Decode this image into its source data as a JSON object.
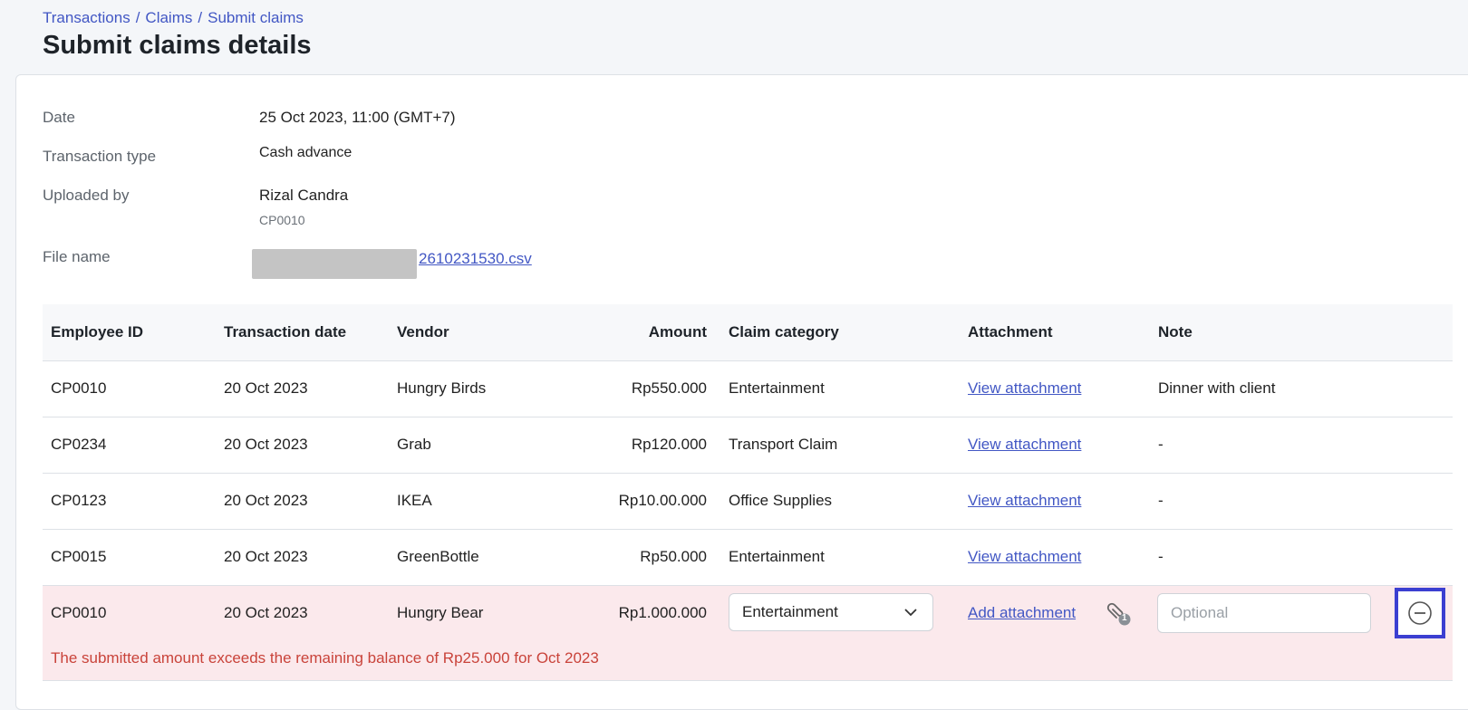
{
  "breadcrumb": {
    "items": [
      "Transactions",
      "Claims",
      "Submit claims"
    ],
    "sep": "/"
  },
  "page_title": "Submit claims details",
  "details": {
    "date_label": "Date",
    "date_value": "25 Oct 2023, 11:00 (GMT+7)",
    "type_label": "Transaction type",
    "type_value": "Cash advance",
    "uploaded_label": "Uploaded by",
    "uploaded_name": "Rizal Candra",
    "uploaded_id": "CP0010",
    "file_label": "File name",
    "file_value": "2610231530.csv"
  },
  "table": {
    "headers": [
      "Employee ID",
      "Transaction date",
      "Vendor",
      "Amount",
      "Claim category",
      "Attachment",
      "Note"
    ],
    "rows": [
      {
        "employee_id": "CP0010",
        "date": "20 Oct 2023",
        "vendor": "Hungry Birds",
        "amount": "Rp550.000",
        "category": "Entertainment",
        "attachment": "View attachment",
        "note": "Dinner with client"
      },
      {
        "employee_id": "CP0234",
        "date": "20 Oct 2023",
        "vendor": "Grab",
        "amount": "Rp120.000",
        "category": "Transport Claim",
        "attachment": "View attachment",
        "note": "-"
      },
      {
        "employee_id": "CP0123",
        "date": "20 Oct 2023",
        "vendor": "IKEA",
        "amount": "Rp10.00.000",
        "category": "Office Supplies",
        "attachment": "View attachment",
        "note": "-"
      },
      {
        "employee_id": "CP0015",
        "date": "20 Oct 2023",
        "vendor": "GreenBottle",
        "amount": "Rp50.000",
        "category": "Entertainment",
        "attachment": "View attachment",
        "note": "-"
      }
    ],
    "edit_row": {
      "employee_id": "CP0010",
      "date": "20 Oct 2023",
      "vendor": "Hungry Bear",
      "amount": "Rp1.000.000",
      "category_selected": "Entertainment",
      "attachment_label": "Add attachment",
      "attachment_count": "1",
      "note_placeholder": "Optional",
      "error": "The submitted amount exceeds the remaining balance of Rp25.000 for Oct 2023"
    }
  },
  "icons": {
    "select": "chevron-down-icon",
    "attach": "paperclip-icon",
    "remove": "minus-circle-icon"
  },
  "colors": {
    "link": "#4257c4",
    "error_bg": "#fbe9ec",
    "error_text": "#c9433a",
    "focus_border": "#3b3fd1"
  }
}
